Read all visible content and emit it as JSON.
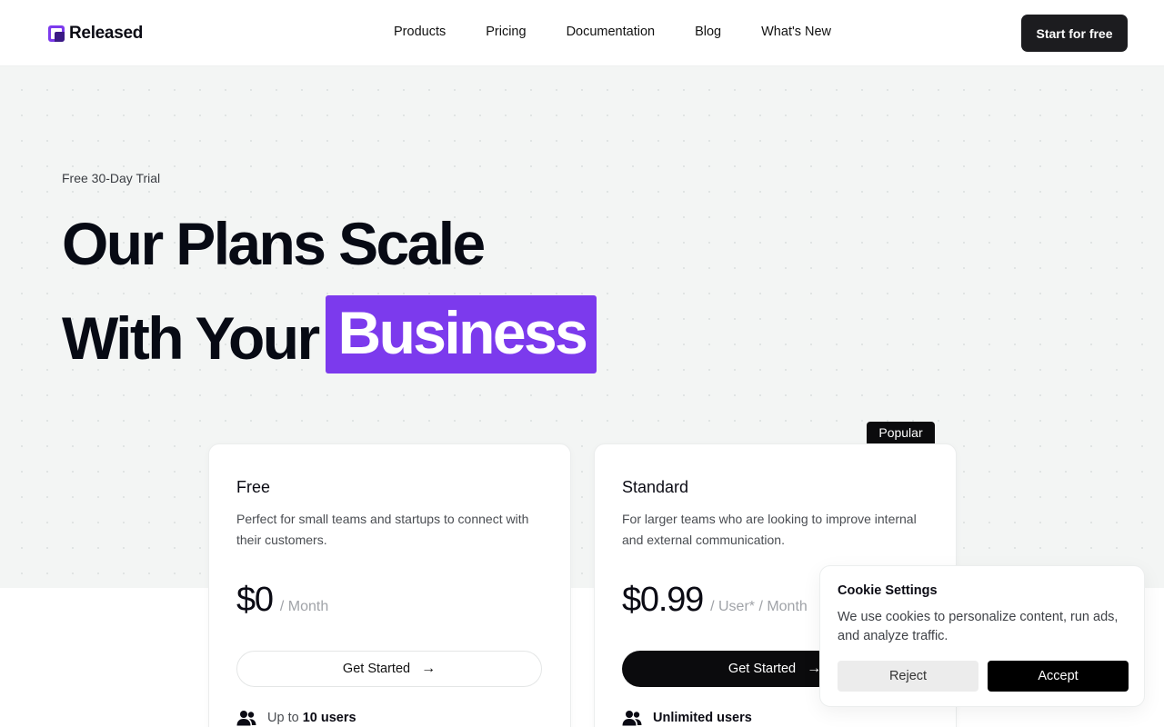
{
  "header": {
    "logo_text": "Released",
    "nav": [
      "Products",
      "Pricing",
      "Documentation",
      "Blog",
      "What's New"
    ],
    "cta_label": "Start for free"
  },
  "hero": {
    "eyebrow": "Free 30-Day Trial",
    "title_line1": "Our Plans Scale",
    "title_line2_prefix": "With Your",
    "title_highlight": "Business",
    "highlight_color": "#7c3aed"
  },
  "plans": [
    {
      "name": "Free",
      "description": "Perfect for small teams and startups to connect with their customers.",
      "price": "$0",
      "unit": "/ Month",
      "button_label": "Get Started",
      "feature_prefix": "Up to",
      "feature_bold": "10 users",
      "icon": "users-icon"
    },
    {
      "name": "Standard",
      "badge": "Popular",
      "description": "For larger teams who are looking to improve internal and external communication.",
      "price": "$0.99",
      "unit": "/ User* / Month",
      "button_label": "Get Started",
      "feature_prefix": "",
      "feature_bold": "Unlimited users",
      "icon": "users-icon"
    }
  ],
  "cookie": {
    "title": "Cookie Settings",
    "text": "We use cookies to personalize content, run ads, and analyze traffic.",
    "reject_label": "Reject",
    "accept_label": "Accept"
  }
}
